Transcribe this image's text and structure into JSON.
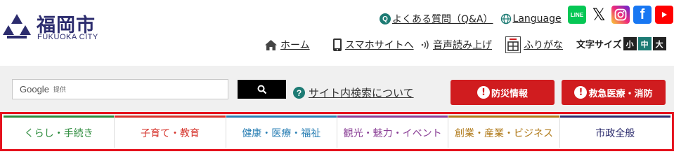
{
  "logo": {
    "title": "福岡市",
    "subtitle": "FUKUOKA CITY",
    "color": "#2c2c6e"
  },
  "top_links": {
    "faq_icon": "Q",
    "faq": "よくある質問（Q&A）",
    "language": "Language"
  },
  "sns": {
    "line": "LINE",
    "x": "𝕏",
    "facebook": "f",
    "items": [
      "line-icon",
      "x-icon",
      "instagram-icon",
      "facebook-icon",
      "youtube-icon"
    ]
  },
  "nav": {
    "home": "ホーム",
    "mobile": "スマホサイトへ",
    "voice": "音声読み上げ",
    "furigana": "ふりがな"
  },
  "font_size": {
    "label": "文字サイズ",
    "small": "小",
    "medium": "中",
    "large": "大",
    "active": "中"
  },
  "search": {
    "brand": "Google",
    "provided": "提供",
    "help_icon": "?",
    "help": "サイト内検索について"
  },
  "alerts": {
    "icon": "!",
    "disaster": "防災情報",
    "emergency": "救急医療・消防",
    "color": "#d01c1f"
  },
  "categories": [
    {
      "label": "くらし・手続き",
      "color": "#2a8a3a"
    },
    {
      "label": "子育て・教育",
      "color": "#d6332b"
    },
    {
      "label": "健康・医療・福祉",
      "color": "#2a7fb4"
    },
    {
      "label": "観光・魅力・イベント",
      "color": "#8a3f96"
    },
    {
      "label": "創業・産業・ビジネス",
      "color": "#b07a1a"
    },
    {
      "label": "市政全般",
      "color": "#2c2c6e"
    }
  ]
}
